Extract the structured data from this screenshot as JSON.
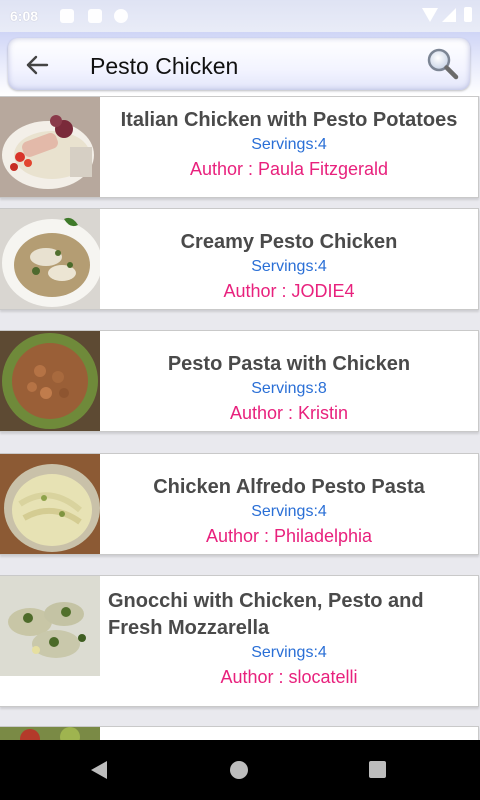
{
  "status_bar": {
    "time": "6:08"
  },
  "search": {
    "query": "Pesto Chicken"
  },
  "recipes": [
    {
      "title": "Italian Chicken with Pesto Potatoes",
      "servings": "Servings:4",
      "author": "Author : Paula Fitzgerald"
    },
    {
      "title": "Creamy Pesto Chicken",
      "servings": "Servings:4",
      "author": "Author : JODIE4"
    },
    {
      "title": "Pesto Pasta with Chicken",
      "servings": "Servings:8",
      "author": "Author : Kristin"
    },
    {
      "title": "Chicken Alfredo Pesto Pasta",
      "servings": "Servings:4",
      "author": "Author : Philadelphia"
    },
    {
      "title": "Gnocchi with Chicken, Pesto and Fresh Mozzarella",
      "servings": "Servings:4",
      "author": "Author : slocatelli"
    }
  ],
  "colors": {
    "title": "#4a4a4a",
    "servings": "#2a6fd6",
    "author": "#e8217d"
  },
  "icons": {
    "back": "arrow-left-icon",
    "search": "magnifier-icon"
  }
}
